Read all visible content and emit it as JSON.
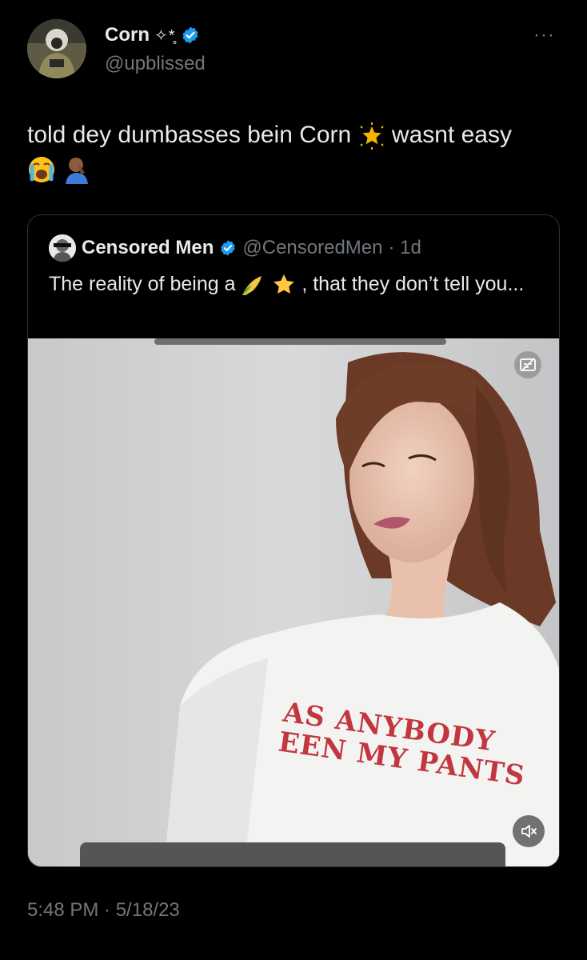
{
  "author": {
    "display_name": "Corn",
    "name_decoration": "✧*̥",
    "handle": "@upblissed"
  },
  "more_label": "···",
  "tweet": {
    "text_part1": "told dey dumbasses bein Corn",
    "text_part2": "wasnt easy"
  },
  "quote": {
    "display_name": "Censored Men",
    "handle": "@CensoredMen",
    "age": "· 1d",
    "text_part1": "The reality of being a",
    "text_part2": ", that they don’t tell you..."
  },
  "video": {
    "shirt_line1": "AS ANYBODY",
    "shirt_line2": "EEN MY PANTS"
  },
  "timestamp": "5:48 PM · 5/18/23",
  "colors": {
    "background": "#000000",
    "text": "#e7e9ea",
    "muted": "#71767b",
    "verified": "#1d9bf0",
    "border": "#2f3336"
  }
}
